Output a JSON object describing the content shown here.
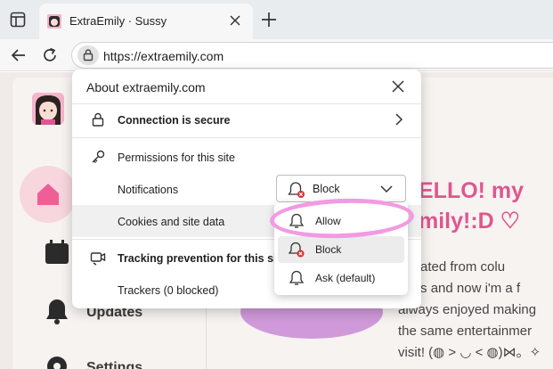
{
  "browser": {
    "tab": {
      "title": "ExtraEmily · Sussy"
    },
    "address_bar": {
      "url": "https://extraemily.com"
    }
  },
  "page": {
    "heading_line1": "ELLO! my",
    "heading_line2": "mily!:D ♡",
    "paragraph_lines": [
      "aduated from colu",
      "ades and now i'm a f",
      "always enjoyed making",
      "the same entertainmer",
      "visit! (◍ > ◡ < ◍)⋈。✧"
    ],
    "sidebar": {
      "items": [
        {
          "label": "Updates",
          "icon": "bell-icon"
        },
        {
          "label": "Settings",
          "icon": "gear-icon"
        }
      ]
    }
  },
  "site_info_popup": {
    "title": "About extraemily.com",
    "connection": {
      "label": "Connection is secure"
    },
    "permissions": {
      "header": "Permissions for this site",
      "notifications": {
        "label": "Notifications",
        "value": "Block"
      },
      "cookies": {
        "label": "Cookies and site data"
      }
    },
    "tracking": {
      "header": "Tracking prevention for this site",
      "trackers": "Trackers (0 blocked)"
    }
  },
  "notifications_dropdown": {
    "options": [
      {
        "label": "Allow",
        "selected": false
      },
      {
        "label": "Block",
        "selected": true
      },
      {
        "label": "Ask (default)",
        "selected": false
      }
    ]
  },
  "colors": {
    "accent_pink": "#e0568f",
    "annotation": "#f29ae2",
    "block_badge": "#d42f2f"
  }
}
